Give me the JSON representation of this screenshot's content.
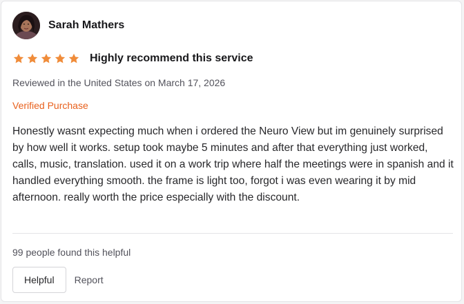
{
  "review": {
    "reviewer": {
      "name": "Sarah Mathers",
      "avatar_icon": "user-avatar-photo"
    },
    "rating": {
      "stars": 5,
      "max_stars": 5,
      "star_color": "#f08c3a",
      "star_icon": "star-icon"
    },
    "title": "Highly recommend this service",
    "meta": "Reviewed in the United States on March 17, 2026",
    "verified_label": "Verified Purchase",
    "verified_color": "#e8601c",
    "body": "Honestly wasnt expecting much when i ordered the Neuro View but im genuinely surprised by how well it works. setup took maybe 5 minutes and after that everything just worked, calls, music, translation. used it on a work trip where half the meetings were in spanish and it handled everything smooth. the frame is light too, forgot i was even wearing it by mid afternoon. really worth the price especially with the discount.",
    "helpful_count_text": "99 people found this helpful",
    "actions": {
      "helpful_label": "Helpful",
      "report_label": "Report"
    }
  }
}
